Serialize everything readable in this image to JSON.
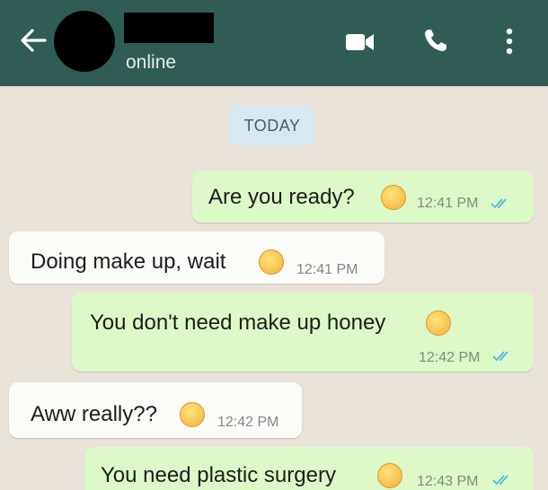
{
  "header": {
    "status": "online",
    "icons": [
      "back-arrow-icon",
      "video-call-icon",
      "phone-call-icon",
      "more-vert-icon"
    ]
  },
  "chat": {
    "date_chip": "TODAY",
    "messages": [
      {
        "direction": "out",
        "text": "Are you ready?",
        "emoji": "confused-face-icon",
        "time": "12:41 PM",
        "read": true
      },
      {
        "direction": "in",
        "text": "Doing make up, wait",
        "emoji": "neutral-face-icon",
        "time": "12:41 PM"
      },
      {
        "direction": "out",
        "text": "You don't need make up honey",
        "emoji": "grinning-face-icon",
        "time": "12:42 PM",
        "read": true
      },
      {
        "direction": "in",
        "text": "Aww really??",
        "emoji": "smiling-face-icon",
        "time": "12:42 PM"
      },
      {
        "direction": "out",
        "text": "You need plastic surgery",
        "emoji": "upside-down-face-icon",
        "time": "12:43 PM",
        "read": true
      }
    ]
  },
  "colors": {
    "header": "#2f5d55",
    "chat_background": "#e8e2d9",
    "outgoing_bubble": "#dcf8c6",
    "incoming_bubble": "#fbfbf8",
    "read_ticks": "#4fb6ec"
  }
}
